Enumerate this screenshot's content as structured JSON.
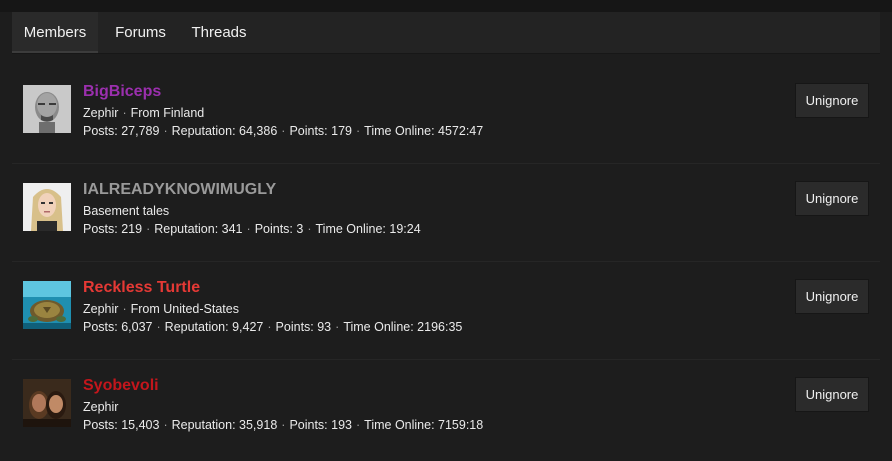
{
  "tabs": {
    "members": "Members",
    "forums": "Forums",
    "threads": "Threads"
  },
  "button_label": "Unignore",
  "members": [
    {
      "name": "BigBiceps",
      "name_color": "#9b2fae",
      "info": [
        "Zephir",
        "From Finland"
      ],
      "stats": [
        "Posts: 27,789",
        "Reputation: 64,386",
        "Points: 179",
        "Time Online: 4572:47"
      ]
    },
    {
      "name": "IALREADYKNOWIMUGLY",
      "name_color": "#9a9a9a",
      "info": [
        "Basement tales"
      ],
      "stats": [
        "Posts: 219",
        "Reputation: 341",
        "Points: 3",
        "Time Online: 19:24"
      ]
    },
    {
      "name": "Reckless Turtle",
      "name_color": "#e53935",
      "info": [
        "Zephir",
        "From United-States"
      ],
      "stats": [
        "Posts: 6,037",
        "Reputation: 9,427",
        "Points: 93",
        "Time Online: 2196:35"
      ]
    },
    {
      "name": "Syobevoli",
      "name_color": "#c4161c",
      "info": [
        "Zephir"
      ],
      "stats": [
        "Posts: 15,403",
        "Reputation: 35,918",
        "Points: 193",
        "Time Online: 7159:18"
      ]
    }
  ]
}
